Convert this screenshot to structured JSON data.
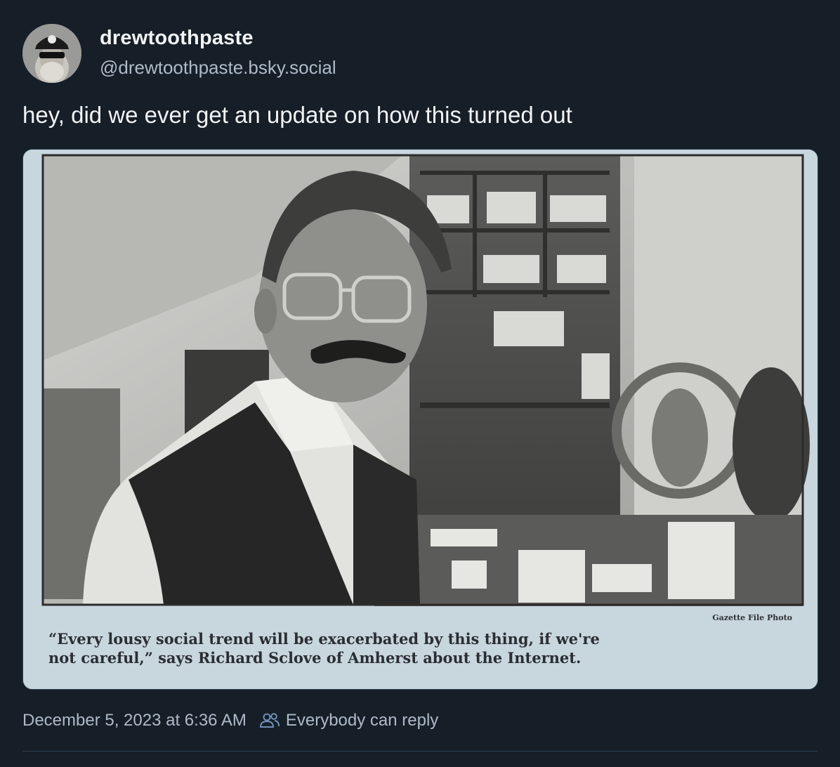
{
  "author": {
    "display_name": "drewtoothpaste",
    "handle": "@drewtoothpaste.bsky.social"
  },
  "post": {
    "text": "hey, did we ever get an update on how this turned out"
  },
  "media": {
    "photo_credit": "Gazette File Photo",
    "caption": "“Every lousy social trend will be exacerbated by this thing, if we're\nnot careful,” says Richard Sclove of Amherst about the Internet."
  },
  "footer": {
    "timestamp": "December 5, 2023 at 6:36 AM",
    "reply_setting": "Everybody can reply",
    "reply_icon": "people-icon"
  },
  "colors": {
    "background": "#161e27",
    "primary_text": "#f1f3f5",
    "secondary_text": "#aebbc9"
  }
}
